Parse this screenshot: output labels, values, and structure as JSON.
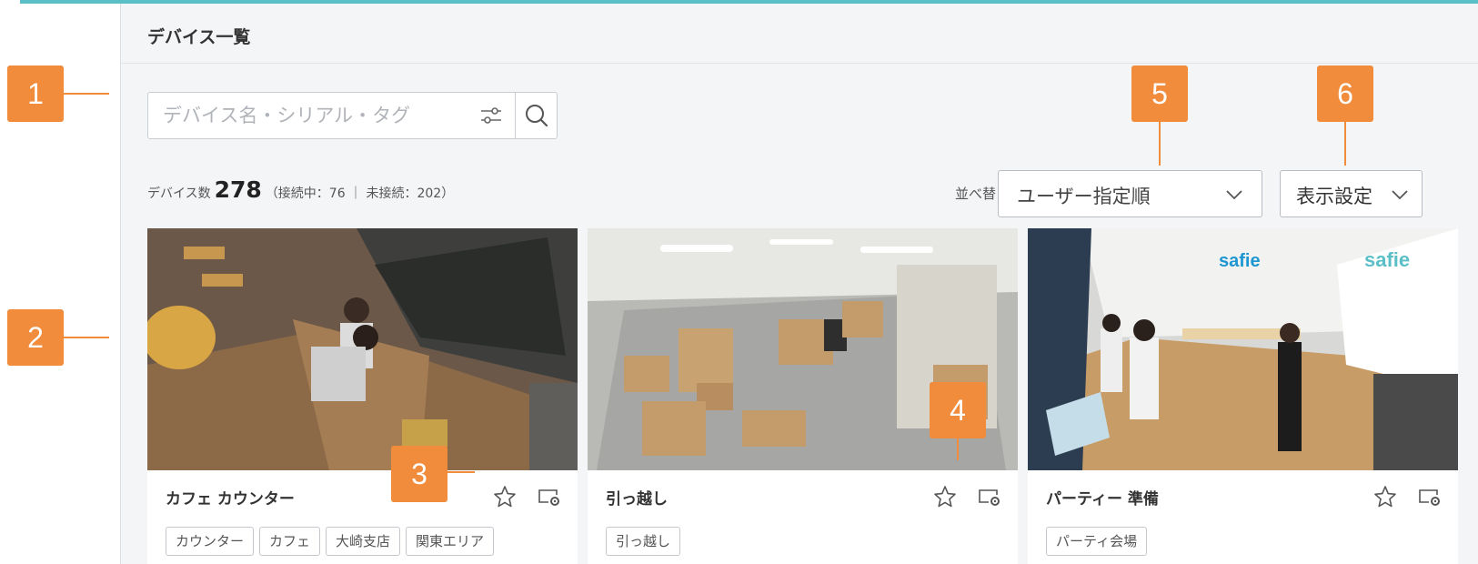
{
  "header": {
    "title": "デバイス一覧"
  },
  "search": {
    "placeholder": "デバイス名・シリアル・タグ"
  },
  "summary": {
    "count_label": "デバイス数",
    "count_value": "278",
    "count_detail": "（接続中：76 ｜ 未接続：202）"
  },
  "sort": {
    "label": "並べ替え",
    "selected": "ユーザー指定順"
  },
  "display": {
    "label": "表示設定"
  },
  "devices": [
    {
      "name": "カフェ カウンター",
      "tags": [
        "カウンター",
        "カフェ",
        "大崎支店",
        "関東エリア"
      ]
    },
    {
      "name": "引っ越し",
      "tags": [
        "引っ越し"
      ]
    },
    {
      "name": "パーティー 準備",
      "tags": [
        "パーティ会場"
      ]
    }
  ],
  "callouts": [
    "1",
    "2",
    "3",
    "4",
    "5",
    "6"
  ],
  "thumbnail_text": {
    "safie_wall": "safie",
    "safie_sign": "safie"
  },
  "icons": {
    "filter": "sliders-icon",
    "search": "magnifier-icon",
    "chevron": "chevron-down-icon",
    "favorite": "star-outline-icon",
    "device_settings": "device-settings-icon"
  },
  "colors": {
    "accent": "#f08c3c",
    "top_bar": "#5bbfc7",
    "panel": "#f4f5f7"
  }
}
